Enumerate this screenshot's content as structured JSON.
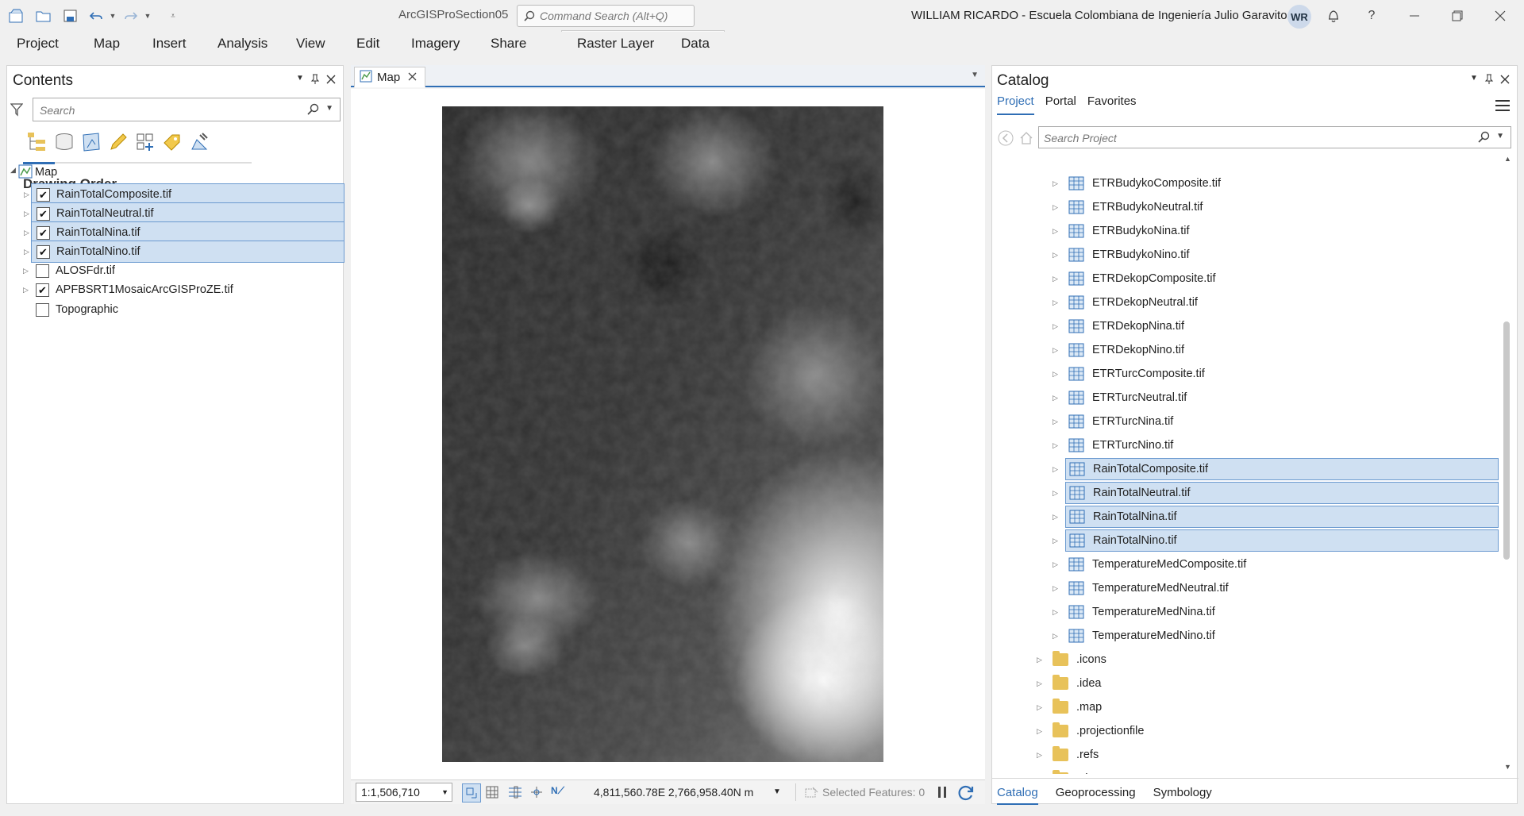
{
  "app": {
    "title": "ArcGISProSection05",
    "command_search_placeholder": "Command Search (Alt+Q)",
    "user": "WILLIAM RICARDO  - Escuela Colombiana de Ingeniería Julio Garavito",
    "avatar_initials": "WR",
    "help": "?"
  },
  "ribbon": {
    "tabs": [
      "Project",
      "Map",
      "Insert",
      "Analysis",
      "View",
      "Edit",
      "Imagery",
      "Share"
    ],
    "contextual_tabs": [
      "Raster Layer",
      "Data"
    ]
  },
  "contents": {
    "title": "Contents",
    "search_placeholder": "Search",
    "drawing_order": "Drawing Order",
    "map_label": "Map",
    "layers": [
      {
        "name": "RainTotalComposite.tif",
        "checked": true,
        "selected": true,
        "expandable": true
      },
      {
        "name": "RainTotalNeutral.tif",
        "checked": true,
        "selected": true,
        "expandable": true
      },
      {
        "name": "RainTotalNina.tif",
        "checked": true,
        "selected": true,
        "expandable": true
      },
      {
        "name": "RainTotalNino.tif",
        "checked": true,
        "selected": true,
        "expandable": true
      },
      {
        "name": "ALOSFdr.tif",
        "checked": false,
        "selected": false,
        "expandable": true
      },
      {
        "name": "APFBSRT1MosaicArcGISProZE.tif",
        "checked": true,
        "selected": false,
        "expandable": true
      },
      {
        "name": "Topographic",
        "checked": false,
        "selected": false,
        "expandable": false
      }
    ]
  },
  "mapview": {
    "tab_label": "Map",
    "scale": "1:1,506,710",
    "coordinates": "4,811,560.78E 2,766,958.40N m",
    "selected_features": "Selected Features: 0"
  },
  "catalog": {
    "title": "Catalog",
    "tabs": [
      "Project",
      "Portal",
      "Favorites"
    ],
    "search_placeholder": "Search Project",
    "items": [
      {
        "name": "ETRBudykoComposite.tif",
        "type": "raster",
        "selected": false
      },
      {
        "name": "ETRBudykoNeutral.tif",
        "type": "raster",
        "selected": false
      },
      {
        "name": "ETRBudykoNina.tif",
        "type": "raster",
        "selected": false
      },
      {
        "name": "ETRBudykoNino.tif",
        "type": "raster",
        "selected": false
      },
      {
        "name": "ETRDekopComposite.tif",
        "type": "raster",
        "selected": false
      },
      {
        "name": "ETRDekopNeutral.tif",
        "type": "raster",
        "selected": false
      },
      {
        "name": "ETRDekopNina.tif",
        "type": "raster",
        "selected": false
      },
      {
        "name": "ETRDekopNino.tif",
        "type": "raster",
        "selected": false
      },
      {
        "name": "ETRTurcComposite.tif",
        "type": "raster",
        "selected": false
      },
      {
        "name": "ETRTurcNeutral.tif",
        "type": "raster",
        "selected": false
      },
      {
        "name": "ETRTurcNina.tif",
        "type": "raster",
        "selected": false
      },
      {
        "name": "ETRTurcNino.tif",
        "type": "raster",
        "selected": false
      },
      {
        "name": "RainTotalComposite.tif",
        "type": "raster",
        "selected": true
      },
      {
        "name": "RainTotalNeutral.tif",
        "type": "raster",
        "selected": true
      },
      {
        "name": "RainTotalNina.tif",
        "type": "raster",
        "selected": true
      },
      {
        "name": "RainTotalNino.tif",
        "type": "raster",
        "selected": true
      },
      {
        "name": "TemperatureMedComposite.tif",
        "type": "raster",
        "selected": false
      },
      {
        "name": "TemperatureMedNeutral.tif",
        "type": "raster",
        "selected": false
      },
      {
        "name": "TemperatureMedNina.tif",
        "type": "raster",
        "selected": false
      },
      {
        "name": "TemperatureMedNino.tif",
        "type": "raster",
        "selected": false
      },
      {
        "name": ".icons",
        "type": "folder",
        "selected": false
      },
      {
        "name": ".idea",
        "type": "folder",
        "selected": false
      },
      {
        "name": ".map",
        "type": "folder",
        "selected": false
      },
      {
        "name": ".projectionfile",
        "type": "folder",
        "selected": false
      },
      {
        "name": ".refs",
        "type": "folder",
        "selected": false
      },
      {
        "name": ".shp",
        "type": "folder",
        "selected": false
      }
    ],
    "bottom_tabs": [
      "Catalog",
      "Geoprocessing",
      "Symbology"
    ]
  },
  "colors": {
    "accent": "#2f6eb5",
    "selection": "#cfe0f2",
    "selection_border": "#6b9ad0",
    "folder": "#e8c25a"
  }
}
